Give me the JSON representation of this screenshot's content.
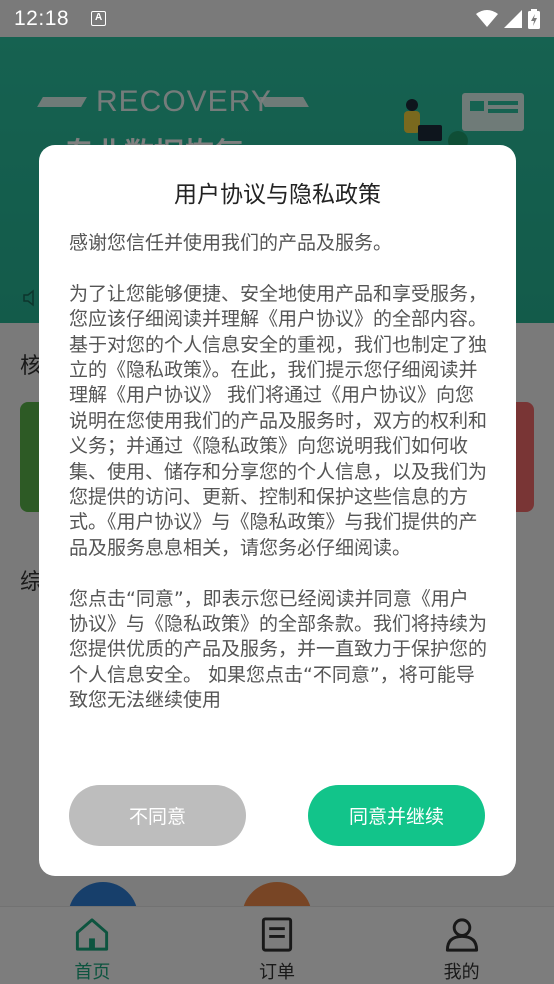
{
  "status_bar": {
    "time": "12:18",
    "notification_letter": "A"
  },
  "banner": {
    "title": "RECOVERY",
    "subtitle": "专业数据恢复"
  },
  "background": {
    "section_1": "核",
    "section_2": "综"
  },
  "bottom_nav": [
    {
      "label": "首页",
      "icon": "home-icon",
      "active": true
    },
    {
      "label": "订单",
      "icon": "orders-icon",
      "active": false
    },
    {
      "label": "我的",
      "icon": "profile-icon",
      "active": false
    }
  ],
  "dialog": {
    "title": "用户协议与隐私政策",
    "paragraphs": [
      "感谢您信任并使用我们的产品及服务。",
      "为了让您能够便捷、安全地使用产品和享受服务，您应该仔细阅读并理解《用户协议》的全部内容。基于对您的个人信息安全的重视，我们也制定了独立的《隐私政策》。在此，我们提示您仔细阅读并理解《用户协议》 我们将通过《用户协议》向您说明在您使用我们的产品及服务时，双方的权利和义务；并通过《隐私政策》向您说明我们如何收集、使用、储存和分享您的个人信息，以及我们为您提供的访问、更新、控制和保护这些信息的方式。《用户协议》与《隐私政策》与我们提供的产品及服务息息相关，请您务必仔细阅读。",
      "您点击“同意”，即表示您已经阅读并同意《用户协议》与《隐私政策》的全部条款。我们将持续为您提供优质的产品及服务，并一直致力于保护您的个人信息安全。 如果您点击“不同意”，将可能导致您无法继续使用"
    ],
    "disagree_label": "不同意",
    "agree_label": "同意并继续"
  },
  "colors": {
    "accent": "#12c48a",
    "disagree": "#bdbdbd",
    "banner": "#2cc4a2"
  }
}
